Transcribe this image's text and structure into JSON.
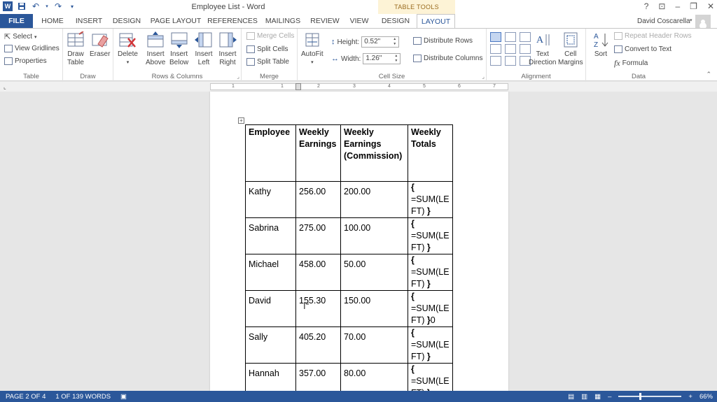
{
  "window": {
    "title": "Employee List - Word"
  },
  "context_tab_group": "TABLE TOOLS",
  "window_controls": {
    "help": "?",
    "restore_ribbon": "⊡",
    "minimize": "–",
    "maximize": "❐",
    "close": "✕"
  },
  "tabs": [
    "FILE",
    "HOME",
    "INSERT",
    "DESIGN",
    "PAGE LAYOUT",
    "REFERENCES",
    "MAILINGS",
    "REVIEW",
    "VIEW",
    "DESIGN",
    "LAYOUT"
  ],
  "user": {
    "name": "David Coscarella"
  },
  "ribbon": {
    "table": {
      "label": "Table",
      "select": "Select",
      "view_gridlines": "View Gridlines",
      "properties": "Properties"
    },
    "draw": {
      "label": "Draw",
      "draw_table_1": "Draw",
      "draw_table_2": "Table",
      "eraser": "Eraser"
    },
    "rows_columns": {
      "label": "Rows & Columns",
      "delete": "Delete",
      "insert_above": [
        "Insert",
        "Above"
      ],
      "insert_below": [
        "Insert",
        "Below"
      ],
      "insert_left": [
        "Insert",
        "Left"
      ],
      "insert_right": [
        "Insert",
        "Right"
      ]
    },
    "merge": {
      "label": "Merge",
      "merge_cells": "Merge Cells",
      "split_cells": "Split Cells",
      "split_table": "Split Table"
    },
    "cell_size": {
      "label": "Cell Size",
      "autofit": "AutoFit",
      "height_label": "Height:",
      "height_value": "0.52\"",
      "width_label": "Width:",
      "width_value": "1.26\"",
      "distribute_rows": "Distribute Rows",
      "distribute_columns": "Distribute Columns"
    },
    "alignment": {
      "label": "Alignment",
      "text_direction": [
        "Text",
        "Direction"
      ],
      "cell_margins": [
        "Cell",
        "Margins"
      ]
    },
    "data": {
      "label": "Data",
      "sort": "Sort",
      "repeat_header_rows": "Repeat Header Rows",
      "convert_to_text": "Convert to Text",
      "formula": "Formula"
    }
  },
  "ruler_numbers": [
    "1",
    "1",
    "2",
    "3",
    "4",
    "5",
    "6",
    "7"
  ],
  "table": {
    "headers": [
      [
        "Employee"
      ],
      [
        "Weekly",
        "Earnings"
      ],
      [
        "Weekly",
        "Earnings",
        "(Commission)"
      ],
      [
        "Weekly",
        "Totals"
      ]
    ],
    "rows": [
      {
        "name": "Kathy",
        "earnings": "256.00",
        "commission": "200.00"
      },
      {
        "name": "Sabrina",
        "earnings": "275.00",
        "commission": "100.00"
      },
      {
        "name": "Michael",
        "earnings": "458.00",
        "commission": "50.00"
      },
      {
        "name": "David",
        "earnings": "155.30",
        "commission": "150.00"
      },
      {
        "name": "Sally",
        "earnings": "405.20",
        "commission": "70.00"
      },
      {
        "name": "Hannah",
        "earnings": "357.00",
        "commission": "80.00"
      }
    ],
    "field": {
      "open": "{",
      "line1": "=SUM(LE",
      "line2": "FT)",
      "close": "}",
      "trailing_david": "0"
    }
  },
  "status": {
    "page": "PAGE 2 OF 4",
    "words": "1 OF 139 WORDS",
    "zoom": "66%"
  }
}
